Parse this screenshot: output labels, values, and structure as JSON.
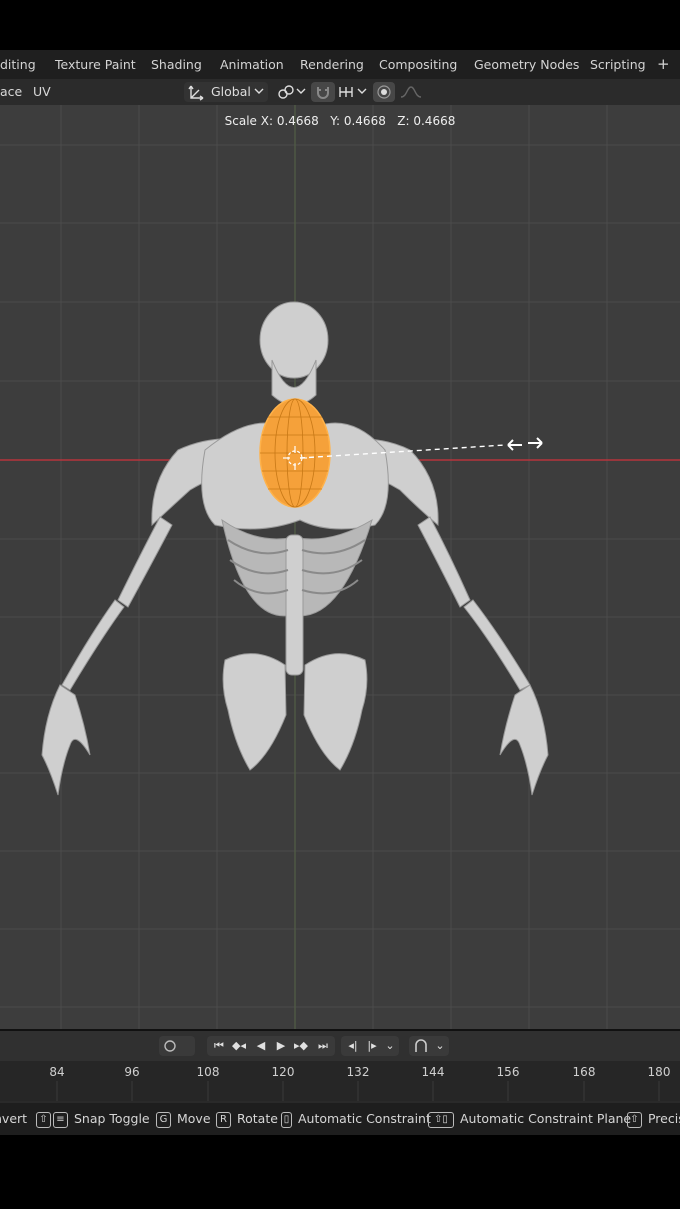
{
  "workspace_tabs": [
    "diting",
    "Texture Paint",
    "Shading",
    "Animation",
    "Rendering",
    "Compositing",
    "Geometry Nodes",
    "Scripting"
  ],
  "add_tab_label": "+",
  "header": {
    "left_items": [
      "ace",
      "UV"
    ],
    "orientation": "Global"
  },
  "scale_readout": "Scale X: 0.4668   Y: 0.4668   Z: 0.4668",
  "timeline": {
    "ticks": [
      "84",
      "96",
      "108",
      "120",
      "132",
      "144",
      "156",
      "168",
      "180"
    ]
  },
  "status_bar": {
    "items": [
      {
        "key": "",
        "label": "nvert"
      },
      {
        "key": "⇧",
        "label": "Snap Toggle"
      },
      {
        "key": "G",
        "label": "Move"
      },
      {
        "key": "R",
        "label": "Rotate"
      },
      {
        "key": "▯",
        "label": "Automatic Constraint"
      },
      {
        "key": "⇧▯",
        "label": "Automatic Constraint Plane"
      },
      {
        "key": "⇧",
        "label": "Precis"
      }
    ]
  },
  "colors": {
    "viewport_bg": "#3d3d3d",
    "selection": "#f5a13a",
    "x_axis": "#b6343c"
  }
}
